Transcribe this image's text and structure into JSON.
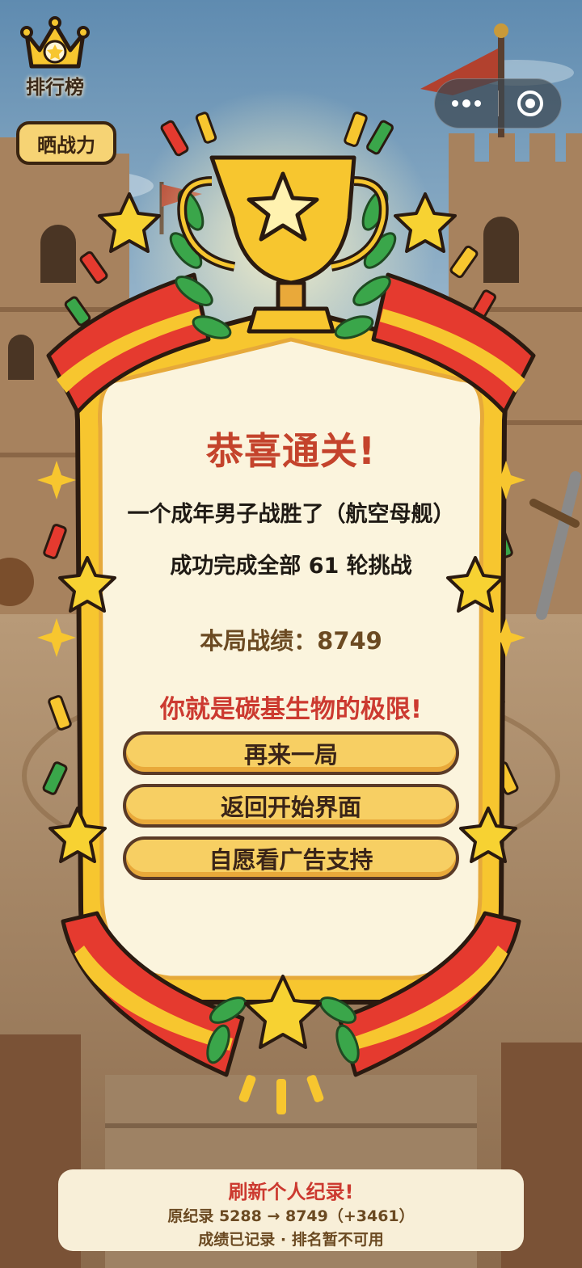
{
  "top_bar": {
    "leaderboard_label": "排行榜",
    "share_button": "晒战力"
  },
  "result": {
    "title": "恭喜通关!",
    "summary": "一个成年男子战胜了（航空母舰）",
    "rounds": "成功完成全部 61 轮挑战",
    "score": "本局战绩：8749",
    "praise": "你就是碳基生物的极限!"
  },
  "buttons": {
    "replay": "再来一局",
    "home": "返回开始界面",
    "ad_support": "自愿看广告支持"
  },
  "record": {
    "headline": "刷新个人纪录!",
    "detail": "原纪录 5288 → 8749（+3461）",
    "status": "成绩已记录 · 排名暂不可用"
  },
  "icons": {
    "leaderboard": "crown-icon",
    "trophy": "trophy-icon",
    "more": "more-dots-icon",
    "close": "target-close-icon"
  },
  "colors": {
    "title": "#c4432c",
    "button": "#f7cf63",
    "frame": "#f7c62f",
    "ribbon_red": "#e53a2f"
  }
}
